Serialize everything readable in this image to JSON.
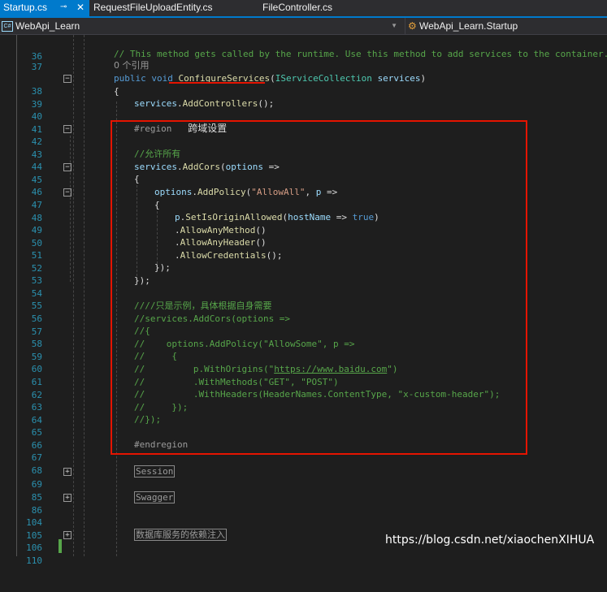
{
  "tabs": [
    {
      "label": "Startup.cs",
      "active": true
    },
    {
      "label": "RequestFileUploadEntity.cs",
      "active": false
    },
    {
      "label": "FileController.cs",
      "active": false
    }
  ],
  "tab_icons": {
    "pin": "pin-icon",
    "close": "close-icon"
  },
  "nav": {
    "project": "WebApi_Learn",
    "member": "WebApi_Learn.Startup"
  },
  "code": {
    "l36": "36",
    "l37": "37",
    "c37": "// This method gets called by the runtime. Use this method to add services to the container.",
    "ref": "0 个引用",
    "l38": "38",
    "c38_public": "public",
    "c38_void": "void",
    "c38_method": "ConfigureServices",
    "c38_open": "(",
    "c38_type": "IServiceCollection",
    "c38_param": "services",
    "c38_close": ")",
    "l39": "39",
    "c39": "{",
    "l40": "40",
    "c40_obj": "services",
    "c40_fn": "AddControllers",
    "c40_rest": "();",
    "l41": "41",
    "l42": "42",
    "c42_kw": "#region",
    "c42_text": "跨域设置",
    "l43": "43",
    "l44": "44",
    "c44": "//允许所有",
    "l45": "45",
    "c45_obj": "services",
    "c45_fn": "AddCors",
    "c45_open": "(",
    "c45_par": "options",
    "c45_rest": " =>",
    "l46": "46",
    "c46": "{",
    "l47": "47",
    "c47_obj": "options",
    "c47_fn": "AddPolicy",
    "c47_open": "(",
    "c47_str": "\"AllowAll\"",
    "c47_comma": ", ",
    "c47_par": "p",
    "c47_rest": " =>",
    "l48": "48",
    "c48": "{",
    "l49": "49",
    "c49_obj": "p",
    "c49_fn": "SetIsOriginAllowed",
    "c49_open": "(",
    "c49_par": "hostName",
    "c49_arrow": " => ",
    "c49_kw": "true",
    "c49_close": ")",
    "l50": "50",
    "c50_fn": "AllowAnyMethod",
    "c50_rest": "()",
    "l51": "51",
    "c51_fn": "AllowAnyHeader",
    "c51_rest": "()",
    "l52": "52",
    "c52_fn": "AllowCredentials",
    "c52_rest": "();",
    "l53": "53",
    "c53": "});",
    "l54": "54",
    "c54": "});",
    "l55": "55",
    "l56": "56",
    "c56": "////只是示例，具体根据自身需要",
    "l57": "57",
    "c57": "//services.AddCors(options =>",
    "l58": "58",
    "c58": "//{",
    "l59": "59",
    "c59": "//    options.AddPolicy(\"AllowSome\", p =>",
    "l60": "60",
    "c60": "//     {",
    "l61": "61",
    "c61_pre": "//         p.WithOrigins(\"",
    "c61_link": "https://www.baidu.com",
    "c61_post": "\")",
    "l62": "62",
    "c62": "//         .WithMethods(\"GET\", \"POST\")",
    "l63": "63",
    "c63": "//         .WithHeaders(HeaderNames.ContentType, \"x-custom-header\");",
    "l64": "64",
    "c64": "//     });",
    "l65": "65",
    "c65": "//});",
    "l66": "66",
    "l67": "67",
    "c67": "#endregion",
    "l68": "68",
    "l69": "69",
    "c69": "Session",
    "l85": "85",
    "l86": "86",
    "c86": "Swagger",
    "l104": "104",
    "l105": "105",
    "l106": "106",
    "c106": "数据库服务的依赖注入",
    "l110": "110"
  },
  "watermark": "https://blog.csdn.net/xiaochenXIHUA",
  "colors": {
    "accent": "#007acc",
    "highlight_border": "#e51400",
    "comment": "#57a64a",
    "keyword": "#569cd6",
    "type": "#4ec9b0",
    "method": "#dcdcaa",
    "string": "#d69d85",
    "line_number": "#2b91af"
  }
}
